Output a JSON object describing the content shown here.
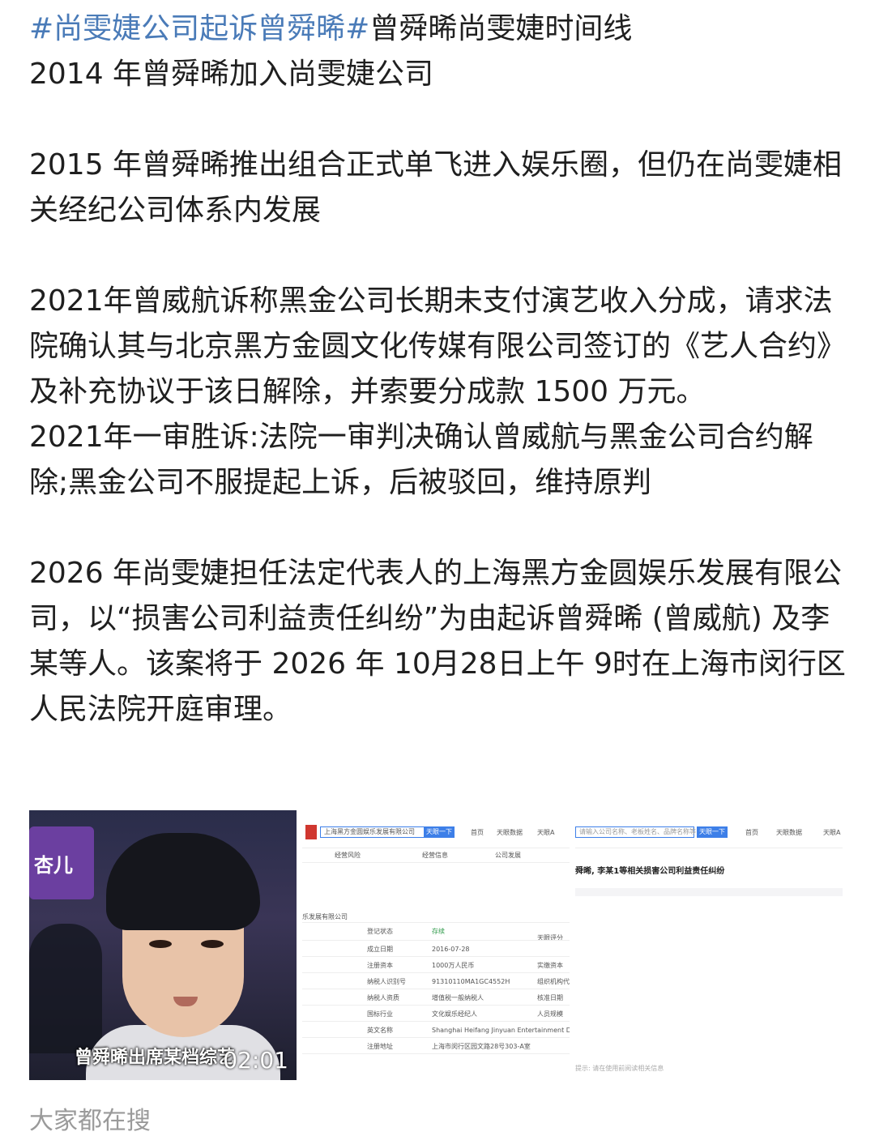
{
  "post": {
    "line1_tag1": "#尚雯婕公司起诉曾舜晞#",
    "line1_text": "曾舜晞尚雯婕时间线",
    "para1": "2014 年曾舜晞加入尚雯婕公司",
    "para2": "2015 年曾舜晞推出组合正式单飞进入娱乐圈，但仍在尚雯婕相关经纪公司体系内发展",
    "para3": "2021年曾威航诉称黑金公司长期未支付演艺收入分成，请求法院确认其与北京黑方金圆文化传媒有限公司签订的《艺人合约》及补充协议于该日解除，并索要分成款 1500 万元。",
    "para4": "2021年一审胜诉:法院一审判决确认曾威航与黑金公司合约解除;黑金公司不服提起上诉，后被驳回，维持原判",
    "para5": "2026 年尚雯婕担任法定代表人的上海黑方金圆娱乐发展有限公司，以“损害公司利益责任纠纷”为由起诉曾舜晞 (曾威航) 及李某等人。该案将于 2026 年 10月28日上午 9时在上海市闵行区人民法院开庭审理。"
  },
  "images": {
    "video": {
      "sign_text": "杏儿",
      "caption": "曾舜晞出席某档综艺",
      "time": "02:01"
    },
    "doc2": {
      "search_text": "上海黑方金圆娱乐发展有限公司",
      "button": "天眼一下",
      "nav": [
        "首页",
        "天眼数据",
        "天眼A"
      ],
      "tabs": [
        "经营风险",
        "经营信息",
        "公司发展"
      ],
      "company_suffix": "乐发展有限公司",
      "rows": [
        [
          "登记状态",
          "存续",
          "天眼评分"
        ],
        [
          "成立日期",
          "2016-07-28",
          ""
        ],
        [
          "注册资本",
          "1000万人民币",
          "实缴资本"
        ],
        [
          "纳税人识别号",
          "91310110MA1GC4552H",
          "组织机构代码"
        ],
        [
          "纳税人资质",
          "增值税一般纳税人",
          "核准日期"
        ],
        [
          "国标行业",
          "文化娱乐经纪人",
          "人员规模"
        ],
        [
          "英文名称",
          "Shanghai Heifang Jinyuan Entertainment Development C",
          ""
        ],
        [
          "注册地址",
          "上海市闵行区园文路28号303-A室",
          ""
        ]
      ]
    },
    "doc3": {
      "search_placeholder": "请输入公司名称、老板姓名、品牌名称等",
      "button": "天眼一下",
      "nav": [
        "首页",
        "天眼数据",
        "天眼A"
      ],
      "title": "舜晞, 李某1等相关损害公司利益责任纠纷",
      "foot": "提示: 请在使用前阅读相关信息"
    }
  },
  "footer": {
    "text": "大家都在搜"
  }
}
